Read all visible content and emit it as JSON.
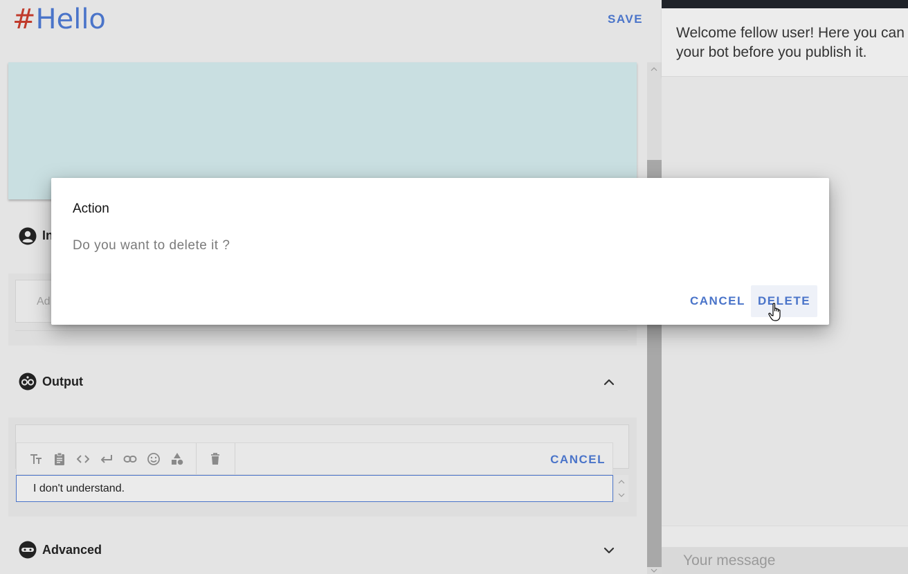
{
  "editor": {
    "title_hash": "#",
    "title_text": "Hello",
    "save_label": "SAVE",
    "intent_title": "In",
    "input_placeholder": "Ad",
    "output_title": "Output",
    "output_toolbar_cancel": "CANCEL",
    "reply_text": "I don't understand.",
    "advanced_title": "Advanced"
  },
  "chat": {
    "welcome_text": "Welcome fellow user! Here you can test your bot before you publish it.",
    "message_placeholder": "Your message"
  },
  "dialog": {
    "title": "Action",
    "message": "Do you want to delete it ?",
    "cancel_label": "CANCEL",
    "delete_label": "DELETE"
  },
  "colors": {
    "accent": "#4a74c9",
    "hash": "#c03a2b",
    "preview_card": "#c9dfe1",
    "chat_topbar": "#1f2329"
  },
  "icons": [
    "user-circle-icon",
    "output-bubble-icon",
    "chevron-up-icon",
    "text-size-icon",
    "clipboard-icon",
    "code-icon",
    "return-icon",
    "link-icon",
    "emoji-icon",
    "shapes-icon",
    "trash-icon",
    "ninja-icon",
    "chevron-down-icon",
    "hand-cursor-icon"
  ]
}
